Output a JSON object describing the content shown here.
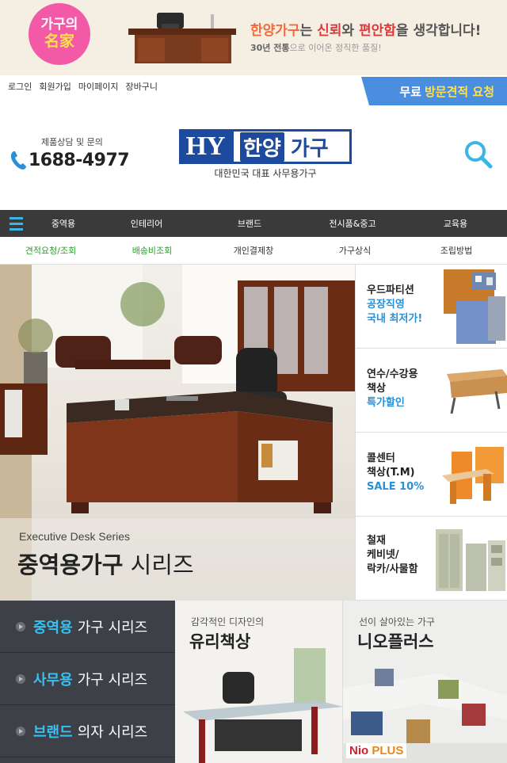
{
  "top_banner": {
    "badge_line1": "가구의",
    "badge_line2": "名家",
    "title_brand": "한양가구",
    "title_mid1": "는 ",
    "title_word1": "신뢰",
    "title_mid2": "와 ",
    "title_word2": "편안함",
    "title_end": "을 생각합니다!",
    "sub_bold": "30년 전통",
    "sub_rest": "으로 이어온 정직한 품질!"
  },
  "util": {
    "links": [
      "로그인",
      "회원가입",
      "마이페이지",
      "장바구니"
    ],
    "visit_prefix": "무료",
    "visit_highlight": "방문견적 요청"
  },
  "header": {
    "phone_label": "제품상담 및 문의",
    "phone_number": "1688-4977",
    "logo_latin": "HY",
    "logo_ko1": "한양",
    "logo_ko2": "가구",
    "logo_tagline": "대한민국 대표 사무용가구"
  },
  "main_nav": [
    "중역용",
    "인테리어",
    "브랜드",
    "전시품&중고",
    "교육용"
  ],
  "sub_nav": [
    "견적요청/조회",
    "배송비조회",
    "개인결제창",
    "가구상식",
    "조립방법"
  ],
  "hero": {
    "series": "Executive Desk Series",
    "title_bold": "중역용가구",
    "title_rest": " 시리즈"
  },
  "side_products": [
    {
      "line1": "우드파티션",
      "line2": "공장직영",
      "line3": "국내 최저가!"
    },
    {
      "line1": "연수/수강용",
      "line2": "책상",
      "line3": "특가할인"
    },
    {
      "line1": "콜센터",
      "line2": "책상(T.M)",
      "line3": "SALE 10%"
    },
    {
      "line1": "철재",
      "line2": "케비넷/",
      "line3": "락카/사물함"
    }
  ],
  "series_menu": [
    {
      "keyword": "중역용",
      "rest": "가구 시리즈"
    },
    {
      "keyword": "사무용",
      "rest": "가구 시리즈"
    },
    {
      "keyword": "브랜드",
      "rest": "의자 시리즈"
    }
  ],
  "promo_glass": {
    "sub": "감각적인 디자인의",
    "title": "유리책상"
  },
  "promo_neo": {
    "sub": "선이 살아있는 가구",
    "title": "니오플러스",
    "logo_n": "Nio",
    "logo_p": "PLUS"
  },
  "colors": {
    "accent_blue": "#2a8fd6",
    "nav_dark": "#3a3a3a",
    "brand_navy": "#1d4a9c",
    "badge_pink": "#f25aa8"
  }
}
